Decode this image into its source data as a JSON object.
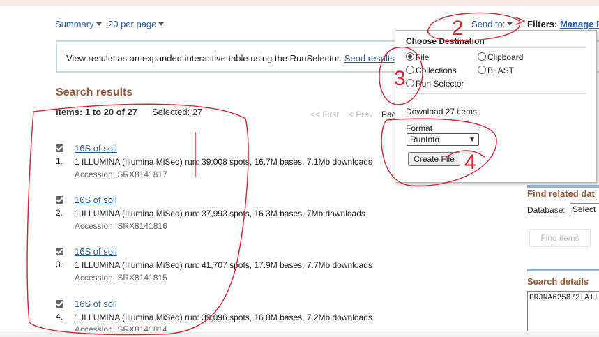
{
  "toolbar": {
    "summary_label": "Summary",
    "per_page_label": "20 per page",
    "send_to_label": "Send to:",
    "filters_label": "Filters:",
    "manage_filters_label": "Manage F"
  },
  "notice": {
    "text": "View results as an expanded interactive table using the RunSelector.",
    "link": "Send results"
  },
  "results": {
    "heading": "Search results",
    "items_count": "Items: 1 to 20 of 27",
    "selected": "Selected: 27",
    "pager_first": "<< First",
    "pager_prev": "< Prev",
    "pager_page": "Pag",
    "items": [
      {
        "num": "1.",
        "title": "16S of soil",
        "desc": "1 ILLUMINA (Illumina MiSeq) run: 39,008 spots, 16.7M bases, 7.1Mb downloads",
        "accession": "Accession: SRX8141817"
      },
      {
        "num": "2.",
        "title": "16S of soil",
        "desc": "1 ILLUMINA (Illumina MiSeq) run: 37,993 spots, 16.3M bases, 7Mb downloads",
        "accession": "Accession: SRX8141816"
      },
      {
        "num": "3.",
        "title": "16S of soil",
        "desc": "1 ILLUMINA (Illumina MiSeq) run: 41,707 spots, 17.9M bases, 7.7Mb downloads",
        "accession": "Accession: SRX8141815"
      },
      {
        "num": "4.",
        "title": "16S of soil",
        "desc": "1 ILLUMINA (Illumina MiSeq) run: 39,096 spots, 16.8M bases, 7.2Mb downloads",
        "accession": "Accession: SRX8141814"
      }
    ]
  },
  "send_to_popup": {
    "heading": "Choose Destination",
    "options": [
      {
        "label": "File",
        "selected": true
      },
      {
        "label": "Clipboard",
        "selected": false
      },
      {
        "label": "Collections",
        "selected": false
      },
      {
        "label": "BLAST",
        "selected": false
      },
      {
        "label": "Run Selector",
        "selected": false
      }
    ],
    "download_text": "Download 27 items.",
    "format_label": "Format",
    "format_value": "RunInfo",
    "create_file_label": "Create File"
  },
  "sidebar": {
    "find_related_heading": "Find related dat",
    "database_label": "Database:",
    "database_value": "Select",
    "find_items_label": "Find items",
    "search_details_heading": "Search details",
    "search_details_value": "PRJNA625872[All"
  },
  "annotations": {
    "color": "#e0202a",
    "numbers": [
      "2",
      "3",
      "4"
    ]
  }
}
